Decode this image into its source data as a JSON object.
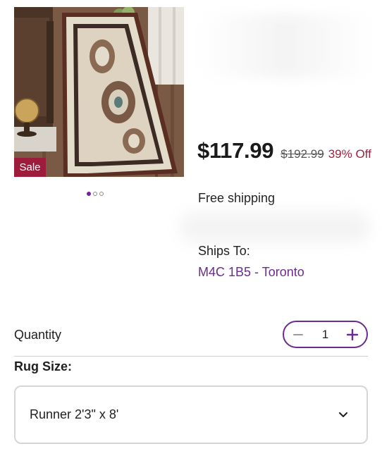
{
  "product": {
    "sale_badge": "Sale",
    "image_count": 3,
    "active_image_index": 0
  },
  "pricing": {
    "current_price": "$117.99",
    "original_price": "$192.99",
    "discount": "39% Off"
  },
  "shipping": {
    "free_shipping": "Free shipping",
    "ships_to_label": "Ships To:",
    "ships_to_location": "M4C 1B5 - Toronto"
  },
  "quantity": {
    "label": "Quantity",
    "value": "1"
  },
  "rug_size": {
    "label": "Rug Size:",
    "selected": "Runner 2'3\" x 8'"
  },
  "colors": {
    "accent": "#6c2b8f",
    "sale": "#9d1b3b",
    "discount": "#a1213e",
    "dot_active": "#7b1fa2"
  },
  "icons": {
    "decrement": "minus-icon",
    "increment": "plus-icon",
    "dropdown": "chevron-down-icon"
  }
}
